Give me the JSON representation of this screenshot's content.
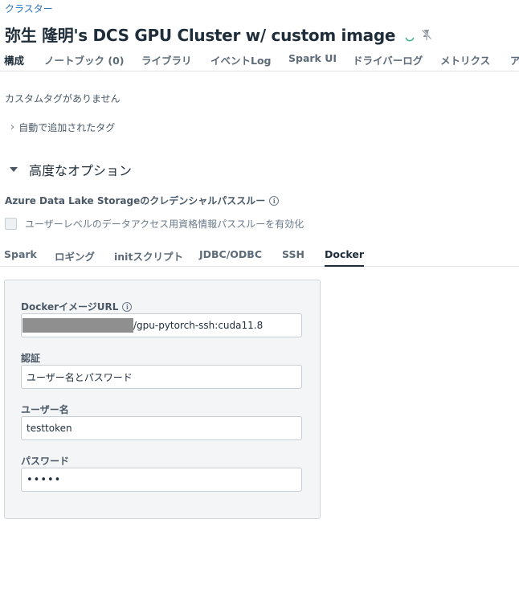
{
  "breadcrumb": "クラスター",
  "page_title": "弥生 隆明's DCS GPU Cluster w/ custom image",
  "main_tabs": [
    "構成",
    "ノートブック (0)",
    "ライブラリ",
    "イベントLog",
    "Spark UI",
    "ドライバーログ",
    "メトリクス",
    "ア"
  ],
  "tags": {
    "no_custom_tags": "カスタムタグがありません",
    "auto_added_tags": "自動で追加されたタグ"
  },
  "advanced_options": {
    "label": "高度なオプション",
    "adls_title": "Azure Data Lake Storageのクレデンシャルパススルー",
    "passthrough_checkbox": "ユーザーレベルのデータアクセス用資格情報パススルーを有効化",
    "passthrough_checked": false
  },
  "sub_tabs": [
    "Spark",
    "ロギング",
    "initスクリプト",
    "JDBC/ODBC",
    "SSH",
    "Docker"
  ],
  "active_sub_tab": "Docker",
  "docker": {
    "image_url_label": "DockerイメージURL",
    "image_url_value": "/gpu-pytorch-ssh:cuda11.8",
    "auth_label": "認証",
    "auth_value": "ユーザー名とパスワード",
    "username_label": "ユーザー名",
    "username_value": "testtoken",
    "password_label": "パスワード",
    "password_value": "•••••"
  },
  "colors": {
    "link": "#2c72b9",
    "spinner": "#3fb38c",
    "active_tab_underline": "#1f2d3a"
  },
  "icons": {
    "status": "spinner-icon",
    "pin": "pin-off-icon",
    "info": "info-icon",
    "expand": "chevron-right-icon",
    "collapse": "caret-down-icon"
  }
}
